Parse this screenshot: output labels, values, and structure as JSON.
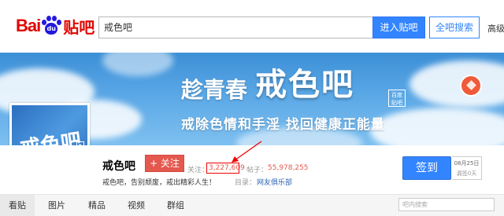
{
  "header": {
    "logo_bai": "Bai",
    "logo_du": "du",
    "logo_tieba": "贴吧",
    "search_value": "戒色吧",
    "enter_button": "进入贴吧",
    "all_search_button": "全吧搜索",
    "advanced_search": "高级搜"
  },
  "banner": {
    "title_left": "趁青春",
    "title_main": "戒色吧",
    "title_tag": "百度贴吧",
    "subtitle": "戒除色情和手淫 找回健康正能量",
    "bg_color": "#4a9ae0"
  },
  "avatar": {
    "text": "戒色吧",
    "badge": ""
  },
  "forum": {
    "name": "戒色吧",
    "follow_button": "+ 关注",
    "follow_label": "关注：",
    "follow_count": "3,227,609",
    "posts_label": "帖子：",
    "posts_count": "55,978,255",
    "slogan": "戒色吧，告别颓废，戒出精彩人生！",
    "directory_label": "目录：",
    "directory_value": "网友俱乐部"
  },
  "sign": {
    "button": "签到",
    "date": "08月25日",
    "streak": "漏签0天"
  },
  "nav": {
    "tabs": [
      "看贴",
      "图片",
      "精品",
      "视频",
      "群组"
    ],
    "search_placeholder": "吧内搜索"
  },
  "colors": {
    "brand_red": "#e10602",
    "brand_blue": "#2319dc",
    "primary_blue": "#3385ff",
    "follow_red": "#e4584d"
  }
}
